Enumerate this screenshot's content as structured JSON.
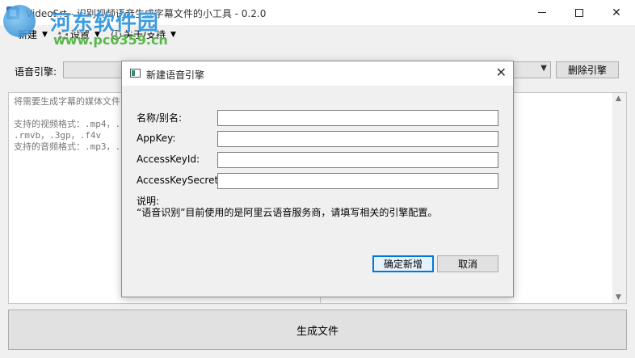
{
  "window": {
    "title": "VideoSrt - 识别视频语音生成字幕文件的小工具 - 0.2.0"
  },
  "watermark": {
    "name": "河东软件园",
    "url": "www.pc0359.cn"
  },
  "menu": {
    "new_label": "新建",
    "settings_label": "设置",
    "about_label": "关于/支持"
  },
  "engine": {
    "label": "语音引擎:",
    "delete_button": "删除引擎"
  },
  "main": {
    "hint_text": "将需要生成字幕的媒体文件\n\n支持的视频格式：.mp4，.\n.rmvb，.3gp，.f4v\n支持的音频格式：.mp3，."
  },
  "generate_button": "生成文件",
  "dialog": {
    "title": "新建语音引擎",
    "fields": [
      {
        "label": "名称/别名:",
        "value": ""
      },
      {
        "label": "AppKey:",
        "value": ""
      },
      {
        "label": "AccessKeyId:",
        "value": ""
      },
      {
        "label": "AccessKeySecret:",
        "value": ""
      }
    ],
    "note_title": "说明:",
    "note_text": "“语音识别”目前使用的是阿里云语音服务商，请填写相关的引擎配置。",
    "confirm_button": "确定新增",
    "cancel_button": "取消"
  },
  "colors": {
    "accent": "#0078d7"
  }
}
